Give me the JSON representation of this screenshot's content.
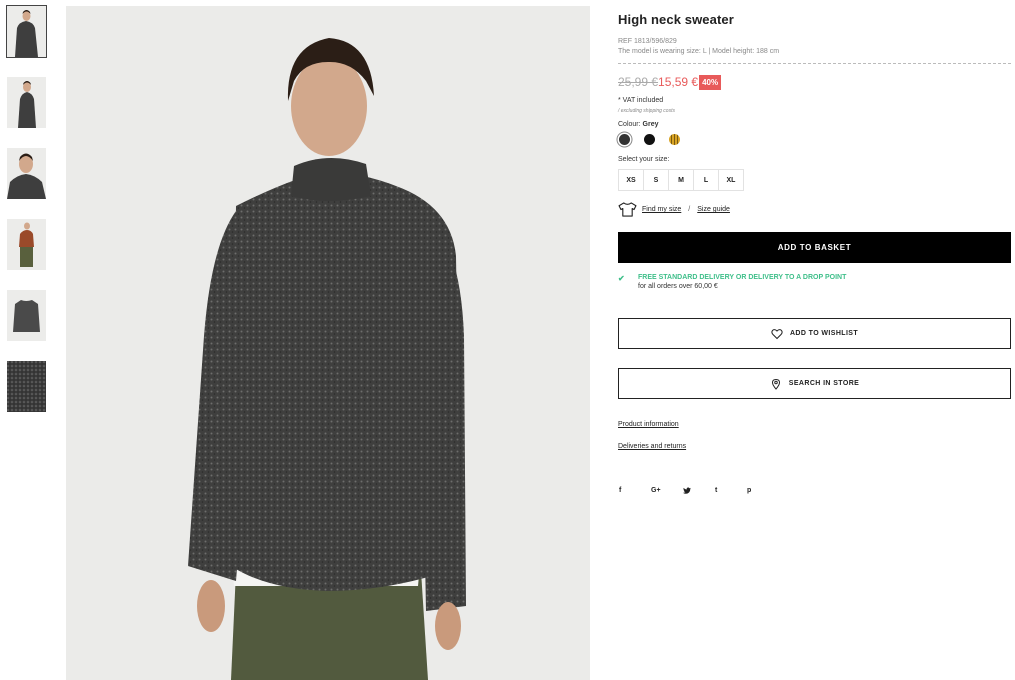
{
  "thumbnails": [
    {
      "name": "thumb-front"
    },
    {
      "name": "thumb-side"
    },
    {
      "name": "thumb-closeup"
    },
    {
      "name": "thumb-full-body"
    },
    {
      "name": "thumb-flat-lay"
    },
    {
      "name": "thumb-fabric"
    }
  ],
  "product": {
    "title": "High neck sweater",
    "ref": "REF 1813/596/829",
    "model_info": "The model is wearing size: L | Model height: 188 cm",
    "old_price": "25,99 €",
    "new_price": "15,59 €",
    "discount": "40%",
    "vat": "* VAT included",
    "shipping_note": "/ excluding shipping costs",
    "colour_label": "Colour:",
    "colour_value": "Grey",
    "swatch_colors": [
      "#333333",
      "#111111",
      "#d9a424"
    ],
    "size_label": "Select your size:",
    "sizes": [
      "XS",
      "S",
      "M",
      "L",
      "XL"
    ],
    "find_my_size": "Find my size",
    "size_separator": "/",
    "size_guide": "Size guide"
  },
  "actions": {
    "add_to_basket": "ADD TO BASKET",
    "delivery_title": "FREE STANDARD DELIVERY OR DELIVERY TO A DROP POINT",
    "delivery_sub": "for all orders over 60,00 €",
    "delivery_icon": "check-icon",
    "add_to_wishlist": "ADD TO WISHLIST",
    "search_in_store": "SEARCH IN STORE"
  },
  "links": {
    "product_information": "Product information",
    "deliveries_returns": "Deliveries and returns"
  },
  "social": [
    "f",
    "G+",
    "t-bird",
    "t",
    "p"
  ],
  "social_icons": {
    "facebook": "f",
    "google_plus": "G+",
    "twitter": "🐦",
    "tumblr": "t",
    "pinterest": "p"
  },
  "colors": {
    "accent_sale": "#e85a5a",
    "accent_delivery": "#3fbf8a",
    "button_primary": "#000000"
  }
}
